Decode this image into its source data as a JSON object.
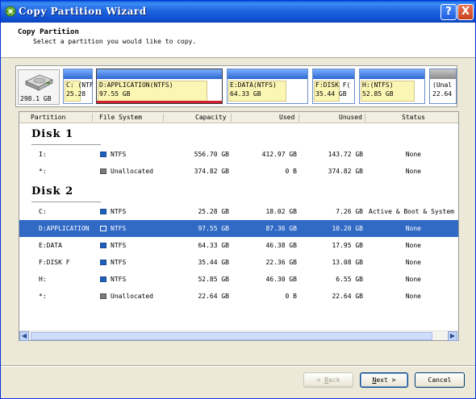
{
  "window": {
    "title": "Copy Partition Wizard",
    "help_label": "?",
    "close_label": "X"
  },
  "header": {
    "title": "Copy Partition",
    "subtitle": "Select a partition you would like to copy."
  },
  "disk_map": {
    "disk_size": "298.1 GB",
    "partitions": [
      {
        "label": "C: (NTF",
        "size": "25.28"
      },
      {
        "label": "D:APPLICATION(NTFS)",
        "size": "97.55 GB",
        "selected": true
      },
      {
        "label": "E:DATA(NTFS)",
        "size": "64.33 GB"
      },
      {
        "label": "F:DISK F(",
        "size": "35.44 GB"
      },
      {
        "label": "H:(NTFS)",
        "size": "52.85 GB"
      },
      {
        "label": "(Unal",
        "size": "22.64",
        "unallocated": true
      }
    ]
  },
  "table": {
    "columns": [
      "Partition",
      "File System",
      "Capacity",
      "Used",
      "Unused",
      "Status"
    ],
    "disks": [
      {
        "name": "Disk 1",
        "rows": [
          {
            "partition": "I:",
            "fs": "NTFS",
            "capacity": "556.70 GB",
            "used": "412.97 GB",
            "unused": "143.72 GB",
            "status": "None"
          },
          {
            "partition": "*:",
            "fs": "Unallocated",
            "capacity": "374.82 GB",
            "used": "0 B",
            "unused": "374.82 GB",
            "status": "None"
          }
        ]
      },
      {
        "name": "Disk 2",
        "rows": [
          {
            "partition": "C:",
            "fs": "NTFS",
            "capacity": "25.28 GB",
            "used": "18.02 GB",
            "unused": "7.26 GB",
            "status": "Active & Boot & System"
          },
          {
            "partition": "D:APPLICATION",
            "fs": "NTFS",
            "capacity": "97.55 GB",
            "used": "87.36 GB",
            "unused": "10.20 GB",
            "status": "None"
          },
          {
            "partition": "E:DATA",
            "fs": "NTFS",
            "capacity": "64.33 GB",
            "used": "46.38 GB",
            "unused": "17.95 GB",
            "status": "None"
          },
          {
            "partition": "F:DISK F",
            "fs": "NTFS",
            "capacity": "35.44 GB",
            "used": "22.36 GB",
            "unused": "13.08 GB",
            "status": "None"
          },
          {
            "partition": "H:",
            "fs": "NTFS",
            "capacity": "52.85 GB",
            "used": "46.30 GB",
            "unused": "6.55 GB",
            "status": "None"
          },
          {
            "partition": "*:",
            "fs": "Unallocated",
            "capacity": "22.64 GB",
            "used": "0 B",
            "unused": "22.64 GB",
            "status": "None"
          }
        ]
      }
    ]
  },
  "buttons": {
    "back": {
      "key": "B",
      "rest": "ack",
      "prefix": "< "
    },
    "next": {
      "key": "N",
      "rest": "ext",
      "suffix": " >"
    },
    "cancel": "Cancel"
  },
  "colors": {
    "titlebar": "#1e64e0",
    "selection": "#316ac5",
    "ntfs": "#1e60c0",
    "unallocated": "#7a7a7a",
    "partition_fill": "#fbf6b4",
    "selected_marker": "#d0202c"
  }
}
